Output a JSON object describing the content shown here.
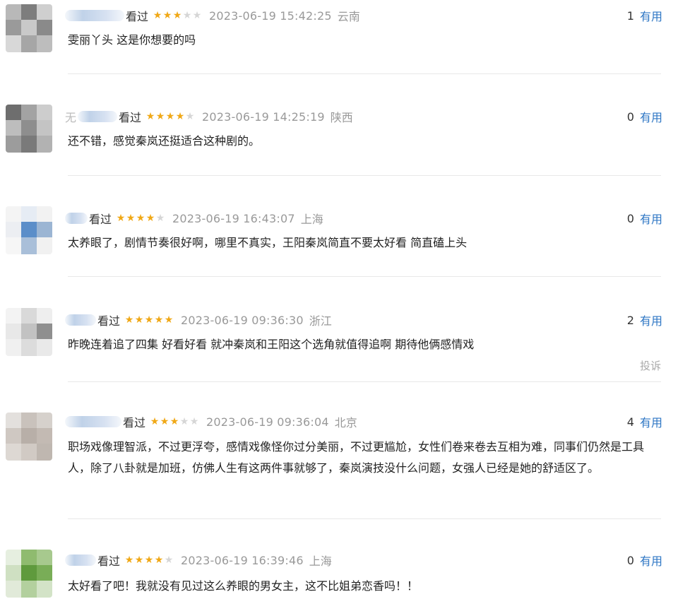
{
  "comments": [
    {
      "seen": "看过",
      "rating": 3,
      "time": "2023-06-19 15:42:25",
      "location": "云南",
      "useful_count": "1",
      "useful_label": "有用",
      "text": "雯丽丫头 这是你想要的吗",
      "name_fragment": ""
    },
    {
      "seen": "看过",
      "rating": 4,
      "time": "2023-06-19 14:25:19",
      "location": "陕西",
      "useful_count": "0",
      "useful_label": "有用",
      "text": "还不错，感觉秦岚还挺适合这种剧的。",
      "name_fragment": "无"
    },
    {
      "seen": "看过",
      "rating": 4,
      "time": "2023-06-19 16:43:07",
      "location": "上海",
      "useful_count": "0",
      "useful_label": "有用",
      "text": "太养眼了，剧情节奏很好啊，哪里不真实，王阳秦岚简直不要太好看 简直磕上头",
      "name_fragment": ""
    },
    {
      "seen": "看过",
      "rating": 5,
      "time": "2023-06-19 09:36:30",
      "location": "浙江",
      "useful_count": "2",
      "useful_label": "有用",
      "text": "昨晚连着追了四集 好看好看 就冲秦岚和王阳这个选角就值得追啊 期待他俩感情戏",
      "report": "投诉",
      "name_fragment": ""
    },
    {
      "seen": "看过",
      "rating": 3,
      "time": "2023-06-19 09:36:04",
      "location": "北京",
      "useful_count": "4",
      "useful_label": "有用",
      "text": "职场戏像理智派，不过更浮夸，感情戏像怪你过分美丽，不过更尴尬，女性们卷来卷去互相为难，同事们仍然是工具人，除了八卦就是加班，仿佛人生有这两件事就够了，秦岚演技没什么问题，女强人已经是她的舒适区了。",
      "name_fragment": ""
    },
    {
      "seen": "看过",
      "rating": 4,
      "time": "2023-06-19 16:39:46",
      "location": "上海",
      "useful_count": "0",
      "useful_label": "有用",
      "text": "太好看了吧！我就没有见过这么养眼的男女主，这不比姐弟恋香吗！！",
      "name_fragment": ""
    }
  ],
  "colors": {
    "star_on": "#f0a816",
    "star_off": "#d6d6d6",
    "link": "#2d76c4",
    "meta_gray": "#999999"
  }
}
